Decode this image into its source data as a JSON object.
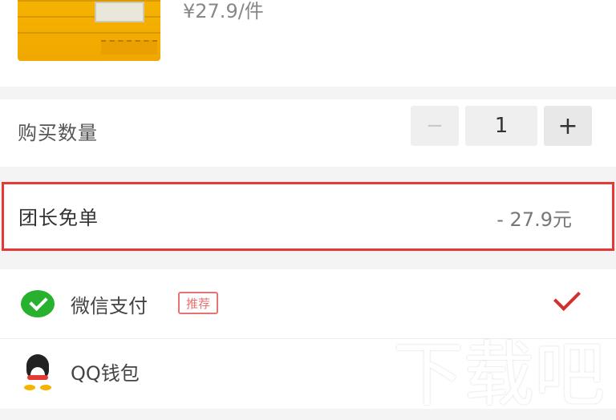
{
  "product": {
    "price": "¥27.9/件"
  },
  "quantity": {
    "label": "购买数量",
    "minus": "−",
    "value": "1",
    "plus": "+"
  },
  "group_leader_free": {
    "label": "团长免单",
    "amount": "- 27.9元",
    "highlight_color": "#e53935"
  },
  "payment": {
    "options": [
      {
        "label": "微信支付",
        "badge": "推荐",
        "selected": true
      },
      {
        "label": "QQ钱包",
        "selected": false
      }
    ],
    "accent": "#d32f2f"
  },
  "watermark": "下载吧"
}
